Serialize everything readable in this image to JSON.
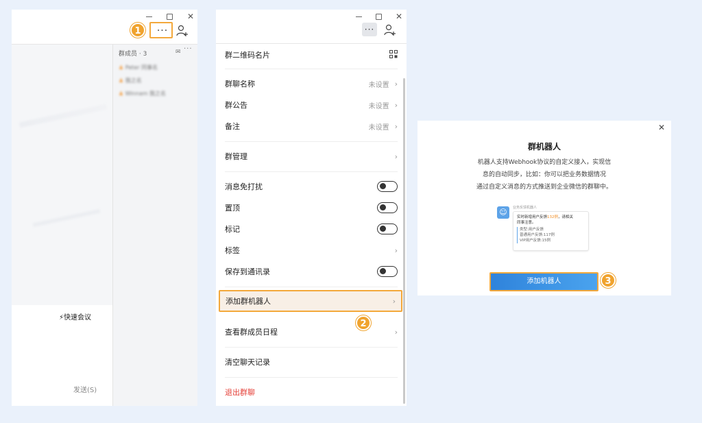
{
  "panel1": {
    "members_header": "群成员 · 3",
    "member_names": [
      "Peter 同事名",
      "我之名",
      "Winnam 我之名"
    ],
    "quick_meeting": "快速会议",
    "send": "发送(S)",
    "badge": "1"
  },
  "panel2": {
    "qr": "群二维码名片",
    "group_name": "群聊名称",
    "group_name_val": "未设置",
    "announcement": "群公告",
    "announcement_val": "未设置",
    "remark": "备注",
    "remark_val": "未设置",
    "manage": "群管理",
    "dnd": "消息免打扰",
    "pin": "置顶",
    "mark": "标记",
    "tag": "标签",
    "save_contacts": "保存到通讯录",
    "add_bot": "添加群机器人",
    "schedule": "查看群成员日程",
    "clear": "清空聊天记录",
    "exit": "退出群聊",
    "badge": "2"
  },
  "panel3": {
    "title": "群机器人",
    "desc_lines": [
      "机器人支持Webhook协议的自定义接入，实现信",
      "息的自动同步，比如：你可以把业务数据情况",
      "通过自定义消息的方式推送到企业微信的群聊中。"
    ],
    "bot_name": "业务反馈机器人",
    "msg_line1_a": "实时新增用户反馈",
    "msg_line1_num": "132例",
    "msg_line1_b": "，请相关",
    "msg_line2": "同事注意。",
    "msg_items": [
      "类型:用户反馈",
      "普通用户反馈:117例",
      "VIP用户反馈:15例"
    ],
    "add_button": "添加机器人",
    "badge": "3"
  }
}
